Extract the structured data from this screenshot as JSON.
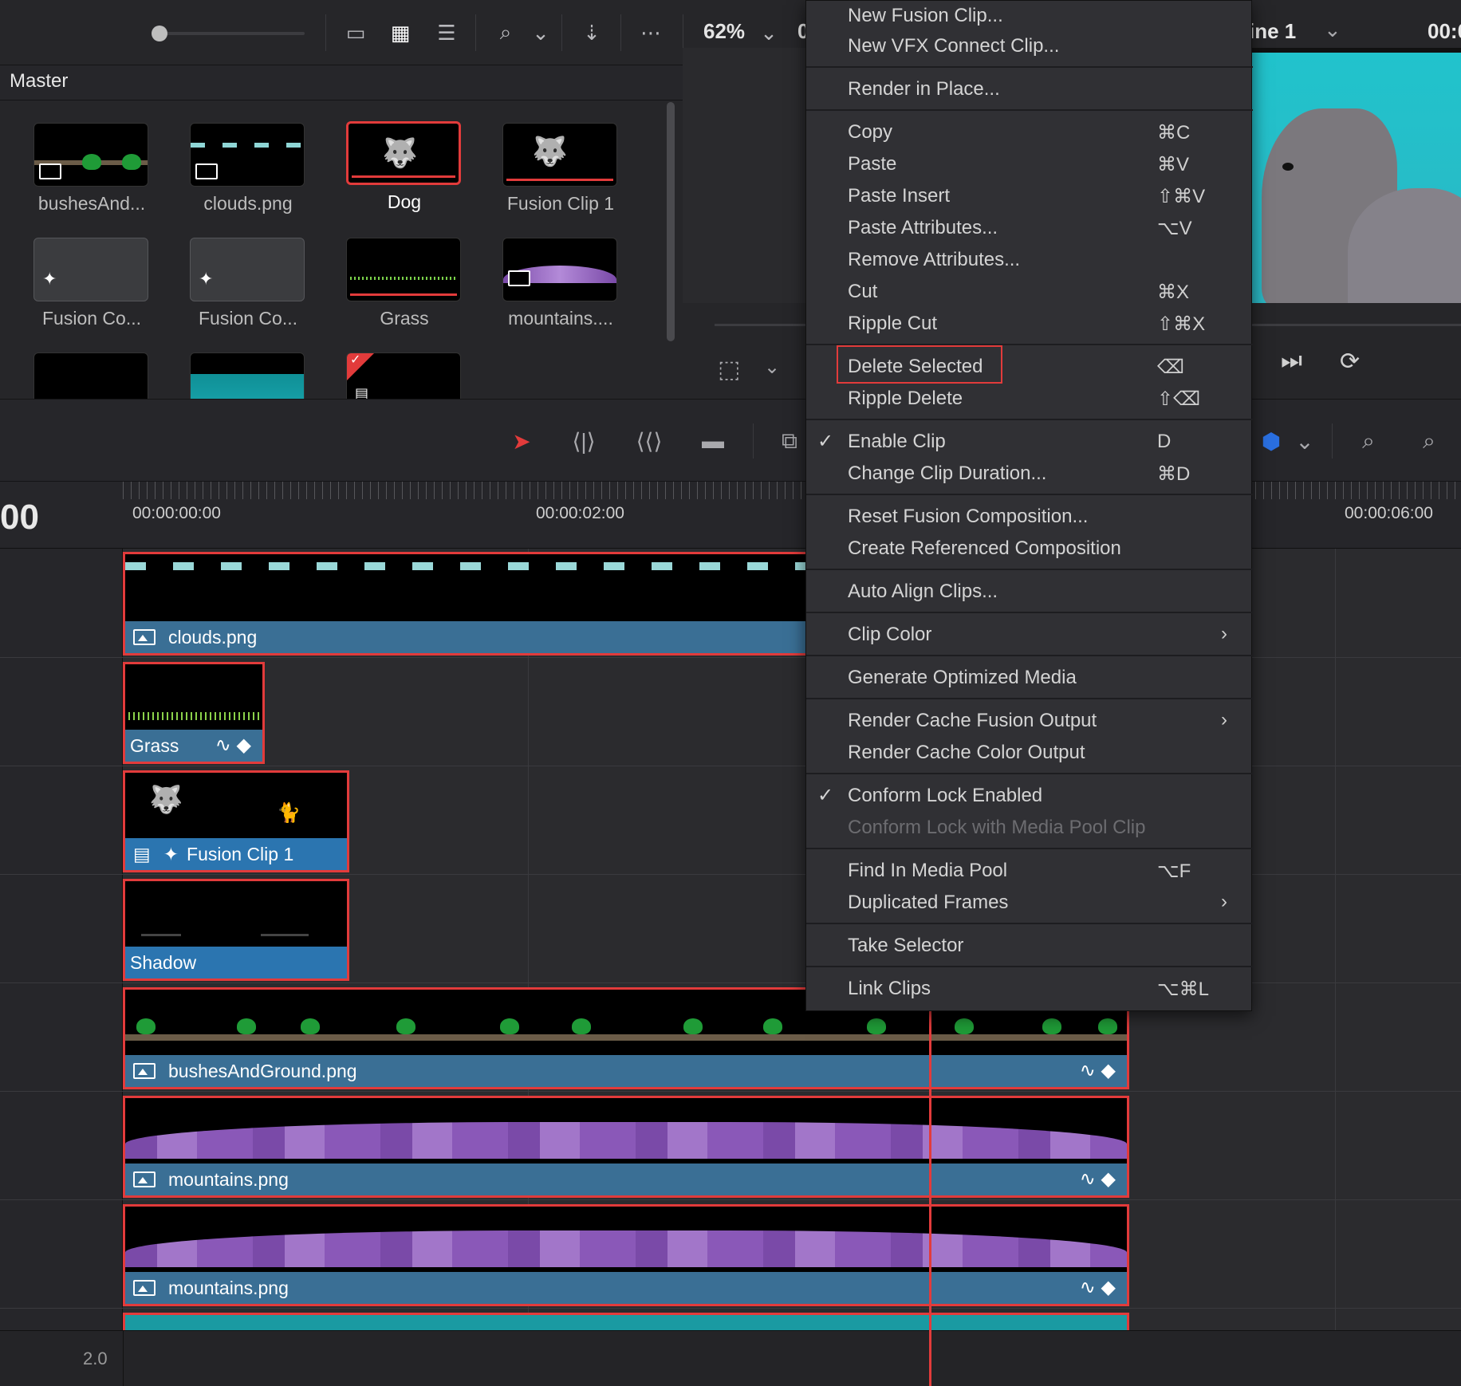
{
  "toolbar": {
    "zoom": "62%",
    "icons": [
      "metadata-view-icon",
      "grid-view-icon",
      "list-view-icon",
      "search-icon",
      "chevron-down-icon",
      "sort-icon",
      "more-icon"
    ]
  },
  "media_pool": {
    "title": "Master",
    "clips": [
      {
        "name": "bushesAnd...",
        "type": "image"
      },
      {
        "name": "clouds.png",
        "type": "image"
      },
      {
        "name": "Dog",
        "type": "dog",
        "selected": true
      },
      {
        "name": "Fusion Clip 1",
        "type": "dog"
      },
      {
        "name": "Fusion Co...",
        "type": "fusion"
      },
      {
        "name": "Fusion Co...",
        "type": "fusion"
      },
      {
        "name": "Grass",
        "type": "grass"
      },
      {
        "name": "mountains....",
        "type": "mountain"
      }
    ]
  },
  "viewer": {
    "timeline_name": "ine 1",
    "timecode": "00:0",
    "clipped_char": "0"
  },
  "ruler": {
    "current_timecode": "00",
    "ticks": [
      "00:00:00:00",
      "00:00:02:00",
      "00:00:06:00"
    ]
  },
  "tracks": {
    "clips": [
      {
        "name": "clouds.png"
      },
      {
        "name": "Grass"
      },
      {
        "name": "Fusion Clip 1"
      },
      {
        "name": "Shadow"
      },
      {
        "name": "bushesAndGround.png"
      },
      {
        "name": "mountains.png"
      },
      {
        "name": "mountains.png"
      }
    ],
    "footer_value": "2.0"
  },
  "context_menu": {
    "items": [
      {
        "label": "New Fusion Clip...",
        "shortcut": ""
      },
      {
        "label": "New VFX Connect Clip...",
        "shortcut": ""
      },
      {
        "label": "Render in Place...",
        "shortcut": ""
      },
      {
        "label": "Copy",
        "shortcut": "⌘C"
      },
      {
        "label": "Paste",
        "shortcut": "⌘V"
      },
      {
        "label": "Paste Insert",
        "shortcut": "⇧⌘V"
      },
      {
        "label": "Paste Attributes...",
        "shortcut": "⌥V"
      },
      {
        "label": "Remove Attributes...",
        "shortcut": ""
      },
      {
        "label": "Cut",
        "shortcut": "⌘X"
      },
      {
        "label": "Ripple Cut",
        "shortcut": "⇧⌘X"
      },
      {
        "label": "Delete Selected",
        "shortcut": "⌫",
        "highlighted": true
      },
      {
        "label": "Ripple Delete",
        "shortcut": "⇧⌫"
      },
      {
        "label": "Enable Clip",
        "shortcut": "D",
        "checked": true
      },
      {
        "label": "Change Clip Duration...",
        "shortcut": "⌘D"
      },
      {
        "label": "Reset Fusion Composition...",
        "shortcut": ""
      },
      {
        "label": "Create Referenced Composition",
        "shortcut": ""
      },
      {
        "label": "Auto Align Clips...",
        "shortcut": ""
      },
      {
        "label": "Clip Color",
        "shortcut": "",
        "submenu": true
      },
      {
        "label": "Generate Optimized Media",
        "shortcut": ""
      },
      {
        "label": "Render Cache Fusion Output",
        "shortcut": "",
        "submenu": true
      },
      {
        "label": "Render Cache Color Output",
        "shortcut": ""
      },
      {
        "label": "Conform Lock Enabled",
        "shortcut": "",
        "checked": true
      },
      {
        "label": "Conform Lock with Media Pool Clip",
        "shortcut": "",
        "disabled": true
      },
      {
        "label": "Find In Media Pool",
        "shortcut": "⌥F"
      },
      {
        "label": "Duplicated Frames",
        "shortcut": "",
        "submenu": true
      },
      {
        "label": "Take Selector",
        "shortcut": ""
      },
      {
        "label": "Link Clips",
        "shortcut": "⌥⌘L"
      }
    ]
  },
  "colors": {
    "accent_red": "#e23b3b",
    "clip_label": "#3a6f95",
    "fusion_label": "#2b75b0",
    "viewer_bg": "#21c3cc"
  }
}
